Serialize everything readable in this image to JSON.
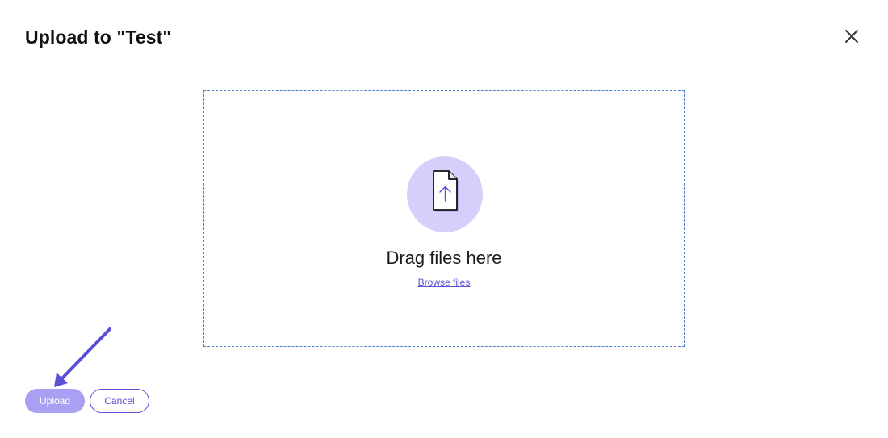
{
  "dialog": {
    "title": "Upload to \"Test\"",
    "close_icon": "close-icon"
  },
  "dropzone": {
    "icon": "file-upload-icon",
    "drag_text": "Drag files here",
    "browse_label": "Browse files"
  },
  "actions": {
    "upload_label": "Upload",
    "cancel_label": "Cancel"
  },
  "annotation": {
    "icon": "arrow-pointer-icon"
  },
  "colors": {
    "accent": "#5a4fd6",
    "upload_button_bg": "#a8a0f2",
    "icon_circle_bg": "#d4d0fb",
    "dropzone_border": "#4a7fcf"
  }
}
